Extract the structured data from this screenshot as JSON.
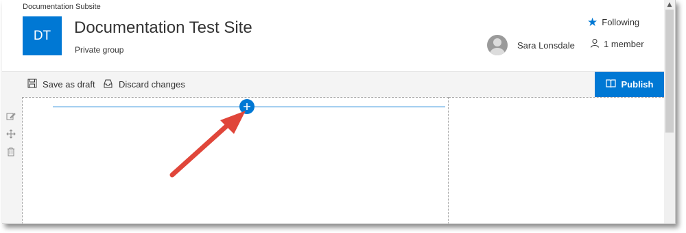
{
  "header": {
    "subsite": "Documentation Subsite",
    "logo_initials": "DT",
    "title": "Documentation Test Site",
    "privacy": "Private group",
    "following_label": "Following",
    "user_name": "Sara Lonsdale",
    "members_label": "1 member"
  },
  "command_bar": {
    "save_label": "Save as draft",
    "discard_label": "Discard changes",
    "publish_label": "Publish"
  },
  "icons": {
    "follow": "star-icon",
    "members": "person-icon",
    "save": "save-icon",
    "discard": "discard-icon",
    "publish": "book-icon",
    "add": "plus-icon",
    "edit": "edit-icon",
    "move": "move-icon",
    "delete": "trash-icon"
  },
  "colors": {
    "accent": "#0078d4",
    "annotation_arrow": "#e0463a"
  }
}
